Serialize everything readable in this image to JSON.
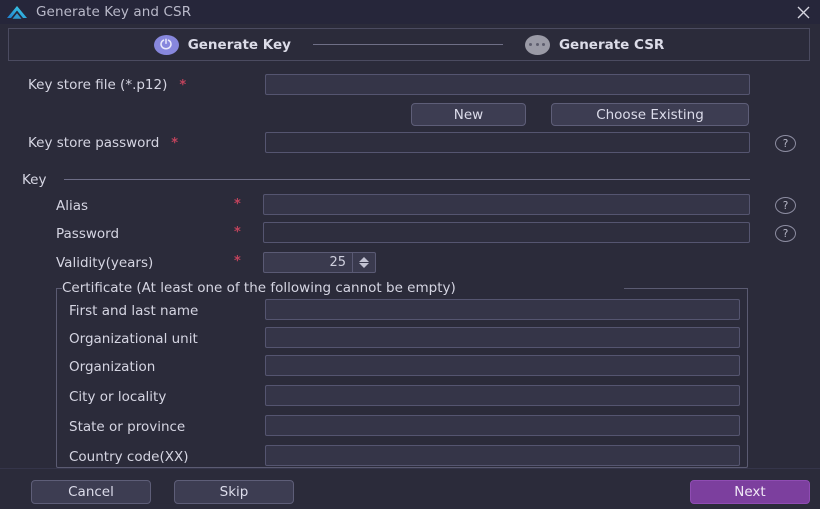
{
  "window": {
    "title": "Generate Key and CSR",
    "logo_icon": "cloud-arrow-logo",
    "close_icon": "close-icon"
  },
  "stepper": {
    "steps": [
      {
        "label": "Generate Key",
        "state": "active",
        "icon": "key-loop-icon"
      },
      {
        "label": "Generate CSR",
        "state": "inactive",
        "icon": "three-dots-icon"
      }
    ]
  },
  "keystore": {
    "file_label": "Key store file (*.p12)",
    "file_required": "*",
    "file_value": "",
    "new_button": "New",
    "choose_existing_button": "Choose Existing",
    "password_label": "Key store password",
    "password_required": "*",
    "password_value": "",
    "password_help": "?"
  },
  "key_group": {
    "title": "Key",
    "alias_label": "Alias",
    "alias_required": "*",
    "alias_value": "",
    "alias_help": "?",
    "password_label": "Password",
    "password_required": "*",
    "password_value": "",
    "password_help": "?",
    "validity_label": "Validity(years)",
    "validity_required": "*",
    "validity_value": "25",
    "spinner_up_icon": "chevron-up-icon",
    "spinner_down_icon": "chevron-down-icon"
  },
  "certificate_group": {
    "title": "Certificate (At least one of the following cannot be empty)",
    "fields": [
      {
        "label": "First and last name",
        "value": ""
      },
      {
        "label": "Organizational unit",
        "value": ""
      },
      {
        "label": "Organization",
        "value": ""
      },
      {
        "label": "City or locality",
        "value": ""
      },
      {
        "label": "State or province",
        "value": ""
      },
      {
        "label": "Country code(XX)",
        "value": ""
      }
    ]
  },
  "footer": {
    "cancel_button": "Cancel",
    "skip_button": "Skip",
    "next_button": "Next"
  },
  "colors": {
    "background": "#2b2b3a",
    "titlebar": "#26263a",
    "field_fill": "#353548",
    "field_border": "#555570",
    "accent_primary": "#7c3f9e",
    "step_active": "#8787dd",
    "step_inactive": "#9a9aa6",
    "required_star": "#c0435c",
    "text": "#d5d5e2"
  }
}
